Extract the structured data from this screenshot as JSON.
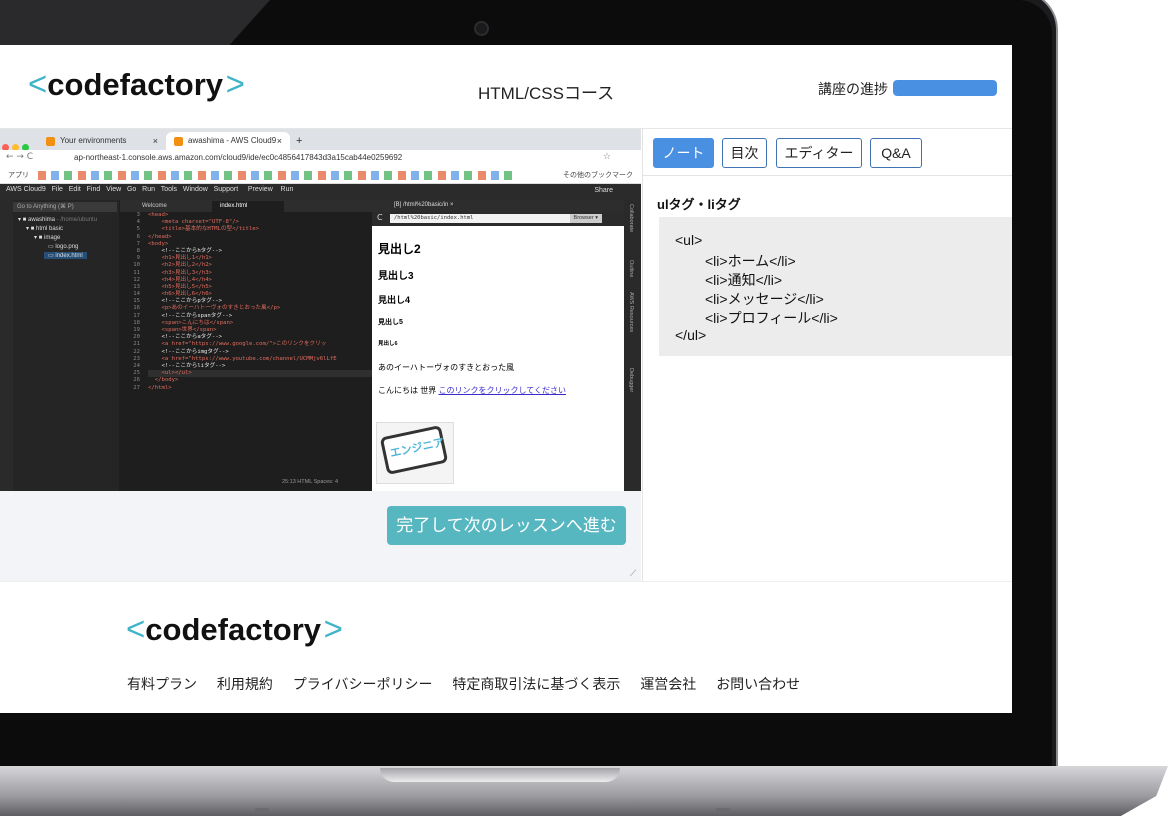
{
  "header": {
    "logo_open": "<",
    "logo_text": "codefactory",
    "logo_close": ">",
    "course_title": "HTML/CSSコース",
    "progress_label": "講座の進捗",
    "progress_value": 1.0
  },
  "video": {
    "browser_tabs": [
      "Your environments",
      "awashima - AWS Cloud9"
    ],
    "url": "ap-northeast-1.console.aws.amazon.com/cloud9/ide/ec0c4856417843d3a15cab44e0259692",
    "bookmarks_label": "アプリ",
    "other_bookmarks": "その他のブックマーク",
    "ide_menu": "AWS Cloud9   File   Edit   Find   View   Go   Run   Tools   Window   Support     Preview    Run",
    "share_label": "Share",
    "goto_label": "Go to Anything (⌘ P)",
    "tree": [
      "awashima",
      "html basic",
      "image",
      "logo.png",
      "index.html"
    ],
    "tree_suffix": "- /home/ubuntu",
    "editor_tabs": [
      "Welcome",
      "index.html"
    ],
    "line_numbers": [
      "3",
      "4",
      "5",
      "6",
      "7",
      "8",
      "9",
      "10",
      "11",
      "12",
      "13",
      "14",
      "15",
      "16",
      "17",
      "18",
      "19",
      "20",
      "21",
      "22",
      "23",
      "24",
      "25",
      "26",
      "27"
    ],
    "code_lines": [
      "<head>",
      "    <meta charset=\"UTF-8\"/>",
      "    <title>基本的なHTMLの型</title>",
      "</head>",
      "<body>",
      "    <!--ここからhタグ-->",
      "    <h1>見出し1</h1>",
      "    <h2>見出し2</h2>",
      "    <h3>見出し3</h3>",
      "    <h4>見出し4</h4>",
      "    <h5>見出し5</h5>",
      "    <h6>見出し6</h6>",
      "    <!--ここからpタグ-->",
      "    <p>あのイーハトーヴォのすきとおった風</p>",
      "    <!--ここからspanタグ-->",
      "    <span>こんにちは</span>",
      "    <span>世界</span>",
      "    <!--ここからaタグ-->",
      "    <a href=\"https://www.google.com/\">このリンクをクリッ",
      "    <!--ここからimgタグ-->",
      "    <a href=\"https://www.youtube.com/channel/UCMMjv6lLfE",
      "    <!--ここからliタグ-->",
      "    <ul></ul>",
      "  </body>",
      "</html>"
    ],
    "status": "25:13  HTML  Spaces: 4",
    "preview_tab": "[B] /html%20basic/in ×",
    "preview_url": "/html%20basic/index.html",
    "browser_btn": "Browser ▾",
    "preview": {
      "h2": "見出し2",
      "h3": "見出し3",
      "h4": "見出し4",
      "h5": "見出し5",
      "h6": "見出し6",
      "p": "あのイーハトーヴォのすきとおった風",
      "span_text": "こんにちは 世界",
      "link_text": "このリンクをクリックしてください",
      "image_text": "エンジニア"
    },
    "right_panels": [
      "Collaborate",
      "Outline",
      "AWS Resources",
      "Debugger"
    ]
  },
  "next_button": "完了して次のレッスンへ進む",
  "side": {
    "tabs": [
      "ノート",
      "目次",
      "エディター",
      "Q&A"
    ],
    "note_title": "ulタグ・liタグ",
    "note_lines": [
      "<ul>",
      "<li>ホーム</li>",
      "<li>通知</li>",
      "<li>メッセージ</li>",
      "<li>プロフィール</li>",
      "</ul>"
    ]
  },
  "footer": {
    "logo_open": "<",
    "logo_text": "codefactory",
    "logo_close": ">",
    "links": [
      "有料プラン",
      "利用規約",
      "プライバシーポリシー",
      "特定商取引法に基づく表示",
      "運営会社",
      "お問い合わせ"
    ]
  },
  "colors": {
    "accent": "#4a90e2",
    "teal": "#56b7c1",
    "logo_bracket": "#3fb3c7"
  }
}
